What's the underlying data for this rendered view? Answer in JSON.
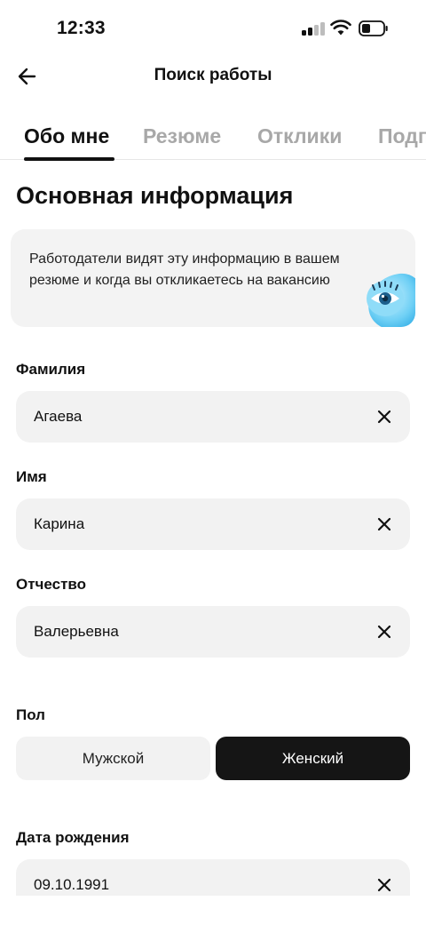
{
  "status_bar": {
    "time": "12:33",
    "signal": "signal-icon",
    "wifi": "wifi-icon",
    "battery": "battery-icon"
  },
  "header": {
    "title": "Поиск работы",
    "back_icon": "arrow-left-icon"
  },
  "tabs": [
    {
      "label": "Обо мне",
      "active": true
    },
    {
      "label": "Резюме",
      "active": false
    },
    {
      "label": "Отклики",
      "active": false
    },
    {
      "label": "Подп",
      "active": false
    }
  ],
  "section": {
    "title": "Основная информация"
  },
  "info_card": {
    "text": "Работодатели видят эту информацию в вашем резюме и когда вы откликаетесь на вакансию",
    "illustration": "eye-icon"
  },
  "fields": {
    "last_name": {
      "label": "Фамилия",
      "value": "Агаева"
    },
    "first_name": {
      "label": "Имя",
      "value": "Карина"
    },
    "patronymic": {
      "label": "Отчество",
      "value": "Валерьевна"
    },
    "birth_date": {
      "label": "Дата рождения",
      "value": "09.10.1991"
    }
  },
  "gender": {
    "label": "Пол",
    "options": [
      {
        "label": "Мужской",
        "selected": false
      },
      {
        "label": "Женский",
        "selected": true
      }
    ]
  },
  "colors": {
    "text": "#111111",
    "tab_inactive": "#a8a8a8",
    "field_bg": "#f2f2f2",
    "selected_bg": "#151515",
    "accent_eye": "#5ec8f0"
  }
}
